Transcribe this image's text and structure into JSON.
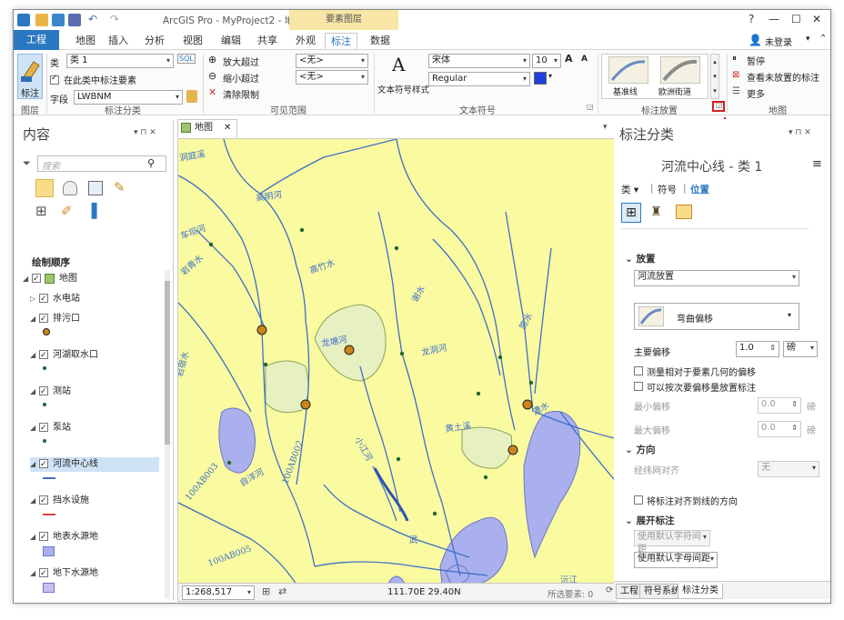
{
  "window": {
    "title": "ArcGIS Pro - MyProject2 - 地图",
    "context_tab_group": "要素图层",
    "help": "?",
    "minimize": "—",
    "maximize": "☐",
    "close": "✕"
  },
  "tabs": [
    "工程",
    "地图",
    "插入",
    "分析",
    "视图",
    "编辑",
    "共享",
    "外观",
    "标注",
    "数据"
  ],
  "user": {
    "label": "未登录",
    "arrow": "▾",
    "collapse": "⌃"
  },
  "ribbon": {
    "layer_group": {
      "button": "标注",
      "label": "图层"
    },
    "label_class": {
      "class_label": "类",
      "class_value": "类 1",
      "only_in_class": "在此类中标注要素",
      "field_label": "字段",
      "field_value": "LWBNM",
      "group": "标注分类",
      "sql": "SQL"
    },
    "visible_range": {
      "zoom_in": "放大超过",
      "zoom_out": "缩小超过",
      "clear": "清除限制",
      "none1": "<无>",
      "none2": "<无>",
      "group": "可见范围"
    },
    "text_symbol": {
      "style_button": "文本符号样式",
      "font": "宋体",
      "size": "10",
      "style": "Regular",
      "group": "文本符号",
      "grow": "A",
      "shrink": "A"
    },
    "label_placement": {
      "item1": "基准线",
      "item2": "欧洲街道",
      "group": "标注放置"
    },
    "map_group": {
      "pause": "暂停",
      "view_unplaced": "查看未放置的标注",
      "more": "更多",
      "group": "地图"
    }
  },
  "contents": {
    "title": "内容",
    "search_placeholder": "搜索",
    "draw_order": "绘制顺序",
    "layers": [
      {
        "name": "地图",
        "checked": true
      },
      {
        "name": "水电站",
        "checked": true
      },
      {
        "name": "排污口",
        "checked": true
      },
      {
        "name": "河湖取水口",
        "checked": true
      },
      {
        "name": "测站",
        "checked": true
      },
      {
        "name": "泵站",
        "checked": true
      },
      {
        "name": "河流中心线",
        "checked": true,
        "selected": true
      },
      {
        "name": "挡水设施",
        "checked": true
      },
      {
        "name": "地表水源地",
        "checked": true
      },
      {
        "name": "地下水源地",
        "checked": true
      }
    ]
  },
  "map": {
    "tab": "地图",
    "scale": "1:268,517",
    "coords": "111.70E 29.40N",
    "selected": "所选要素: 0",
    "labels": [
      "洞庭溪",
      "高明河",
      "车坝河",
      "岩青水",
      "高竹水",
      "龙塘河",
      "谢水",
      "施水",
      "龙洞河",
      "岩宿水",
      "小江河",
      "自洋河",
      "100AB002",
      "100AB003",
      "100AB005",
      "黄土溪",
      "澧水",
      "武",
      "沅江"
    ]
  },
  "label_panel": {
    "title": "标注分类",
    "heading": "河流中心线 - 类 1",
    "subtabs": [
      "类",
      "符号",
      "位置"
    ],
    "placement_section": "放置",
    "placement_value": "河流放置",
    "offset_style": "弯曲偏移",
    "primary_offset_label": "主要偏移",
    "primary_offset_value": "1.0",
    "unit": "磅",
    "measure_offset": "测量相对于要素几何的偏移",
    "step_offset": "可以按次要偏移量放置标注",
    "min_offset_label": "最小偏移",
    "min_offset_value": "0.0",
    "max_offset_label": "最大偏移",
    "max_offset_value": "0.0",
    "unit2": "磅",
    "unit3": "磅",
    "orientation_section": "方向",
    "graticule_align": "经纬网对齐",
    "graticule_value": "无",
    "align_to_line": "将标注对齐到线的方向",
    "spread_section": "展开标注",
    "char_spacing": "使用默认字符间距",
    "letter_spacing": "使用默认字母间距",
    "bottom_tabs": [
      "工程",
      "符号系统",
      "标注分类"
    ]
  },
  "colors": {
    "accent": "#2b78c2",
    "map_bg": "#fafaa0",
    "river": "#3d6fc8",
    "lake": "#aab0ee",
    "wetland": "#e6f0c0",
    "callout": "#d81e1e"
  }
}
